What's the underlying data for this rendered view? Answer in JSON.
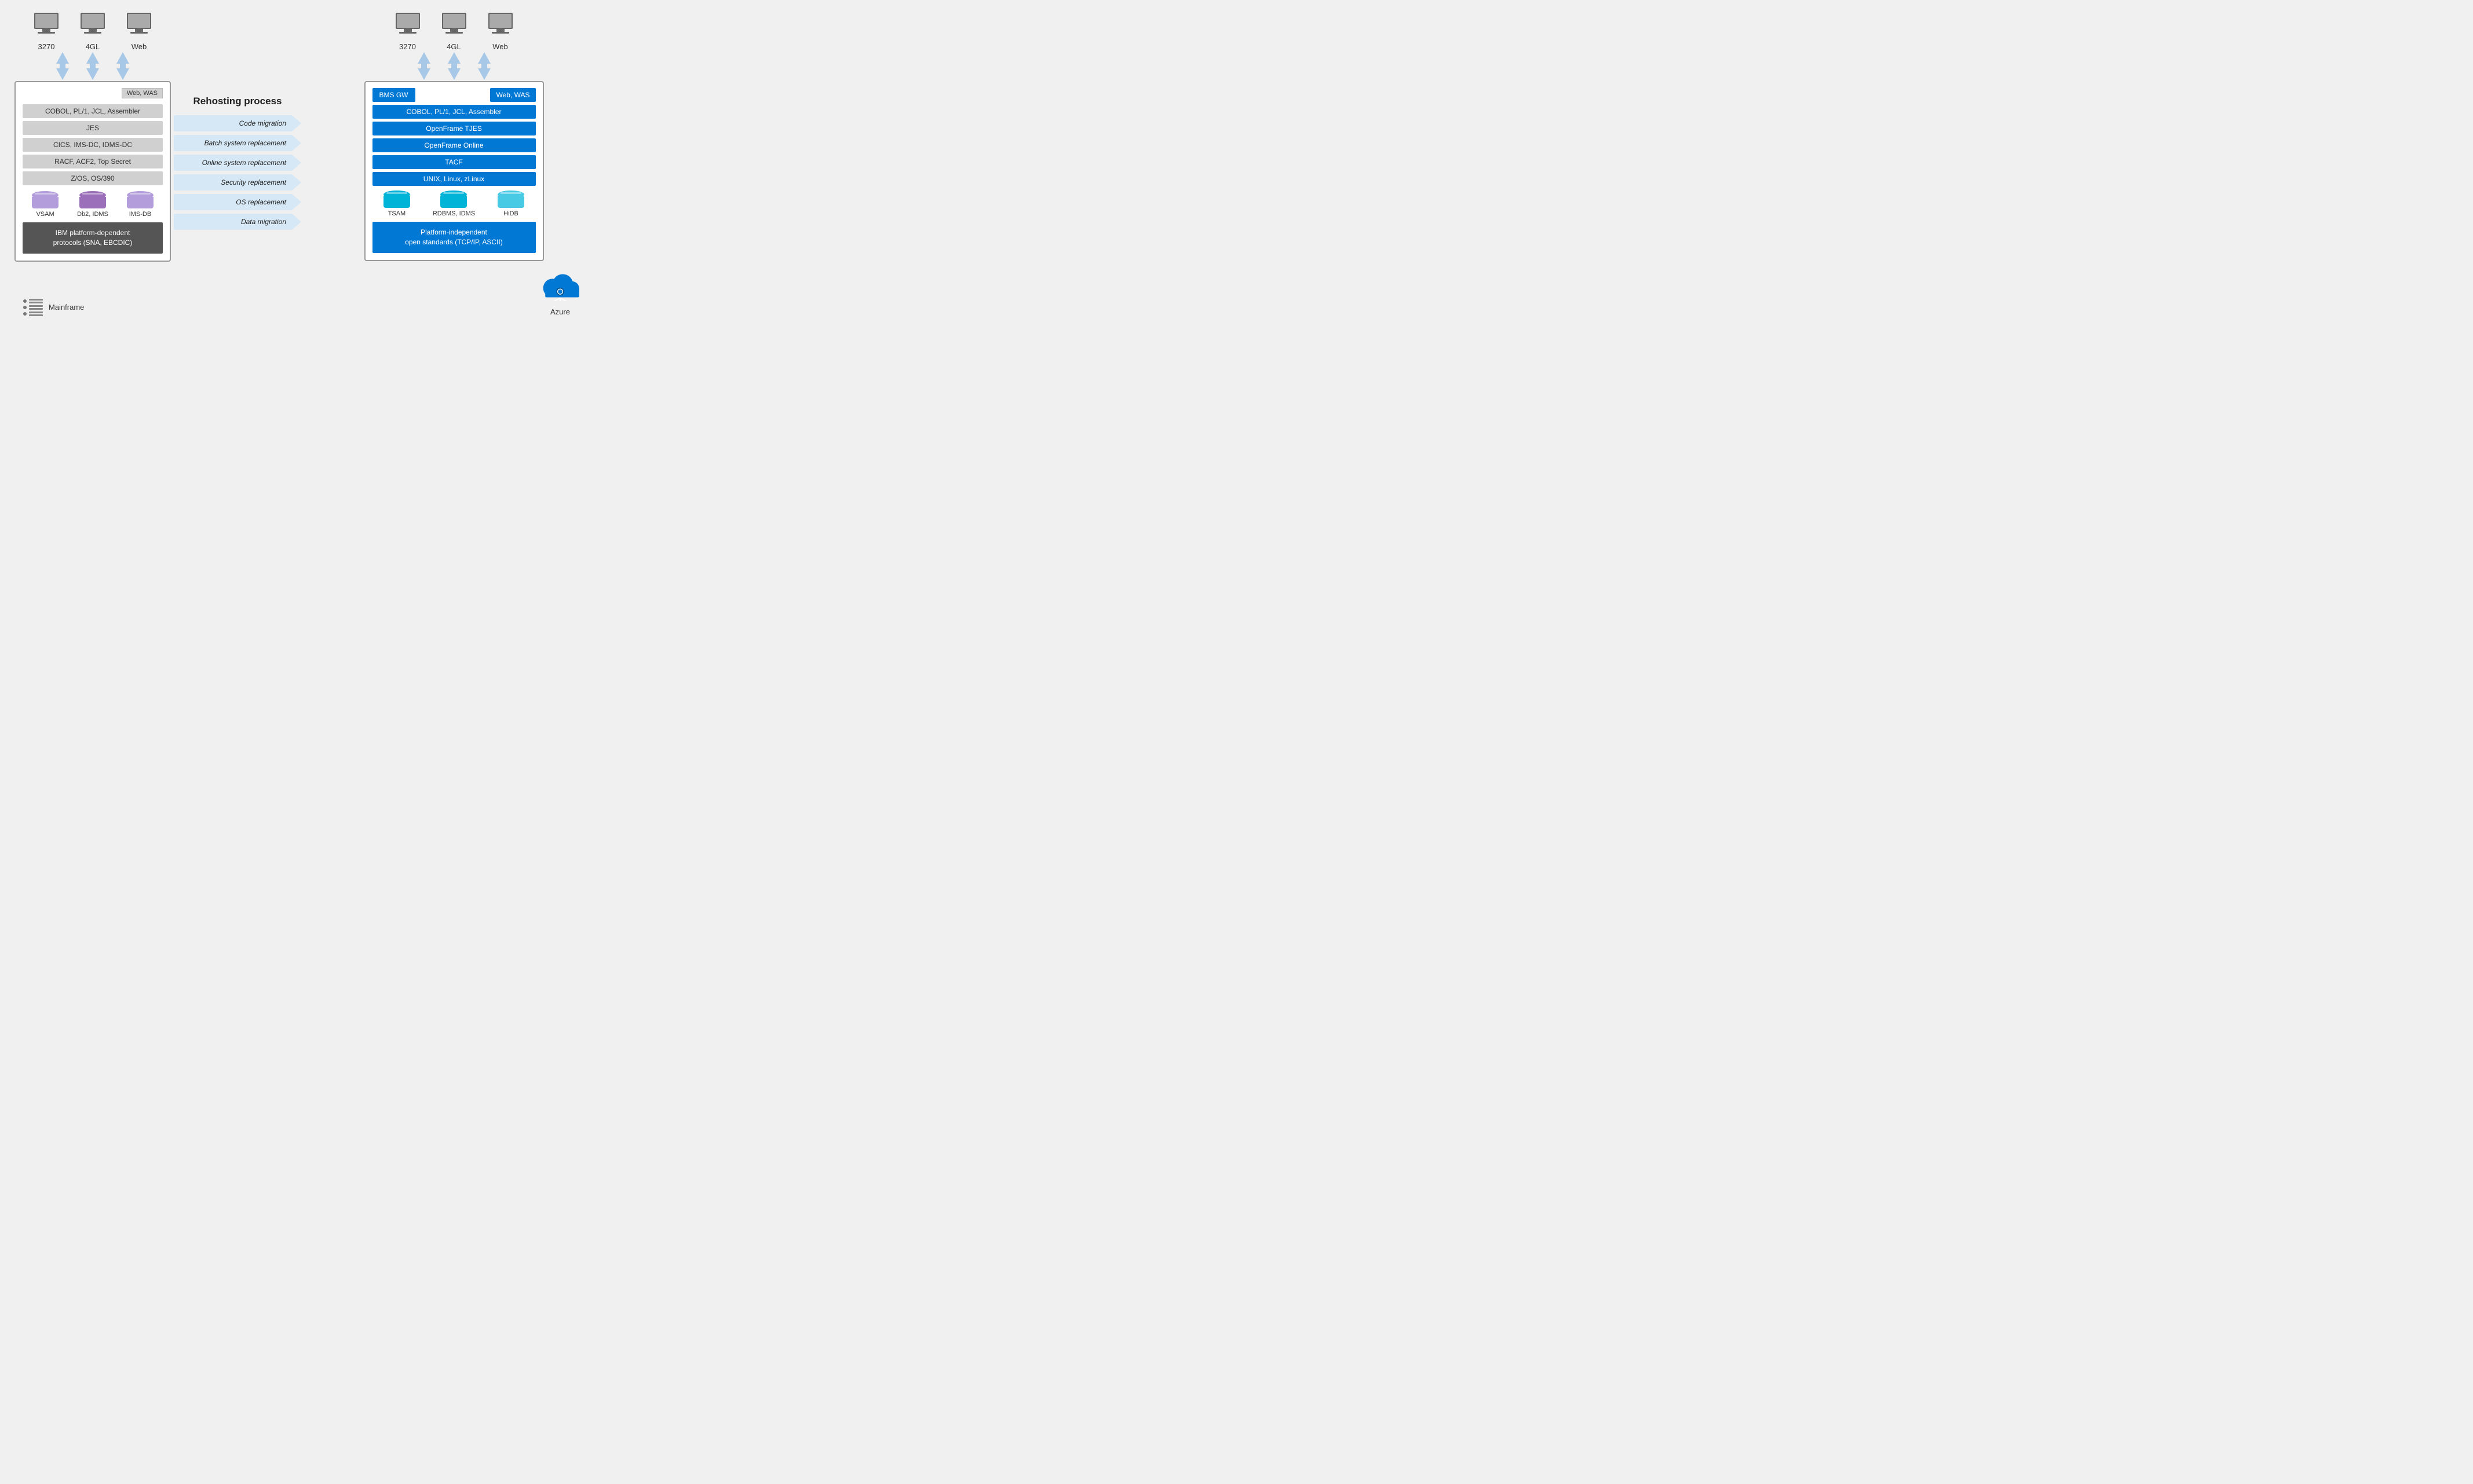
{
  "left": {
    "terminals": [
      {
        "label": "3270"
      },
      {
        "label": "4GL"
      },
      {
        "label": "Web"
      }
    ],
    "web_was": "Web, WAS",
    "rows": [
      "COBOL, PL/1, JCL, Assembler",
      "JES",
      "CICS, IMS-DC, IDMS-DC",
      "RACF, ACF2, Top Secret",
      "Z/OS, OS/390"
    ],
    "databases": [
      {
        "label": "VSAM"
      },
      {
        "label": "Db2, IDMS"
      },
      {
        "label": "IMS-DB"
      }
    ],
    "protocols": "IBM platform-dependent\nprotocols (SNA, EBCDIC)"
  },
  "middle": {
    "title": "Rehosting process",
    "steps": [
      "Code migration",
      "Batch system replacement",
      "Online system replacement",
      "Security replacement",
      "OS replacement",
      "Data migration"
    ]
  },
  "right": {
    "terminals": [
      {
        "label": "3270"
      },
      {
        "label": "4GL"
      },
      {
        "label": "Web"
      }
    ],
    "bms_gw": "BMS GW",
    "web_was": "Web, WAS",
    "rows": [
      "COBOL, PL/1, JCL, Assembler",
      "OpenFrame TJES",
      "OpenFrame Online",
      "TACF",
      "UNIX, Linux, zLinux"
    ],
    "databases": [
      {
        "label": "TSAM"
      },
      {
        "label": "RDBMS, IDMS"
      },
      {
        "label": "HiDB"
      }
    ],
    "protocols": "Platform-independent\nopen standards (TCP/IP, ASCII)"
  },
  "bottom": {
    "mainframe_label": "Mainframe",
    "azure_label": "Azure"
  }
}
